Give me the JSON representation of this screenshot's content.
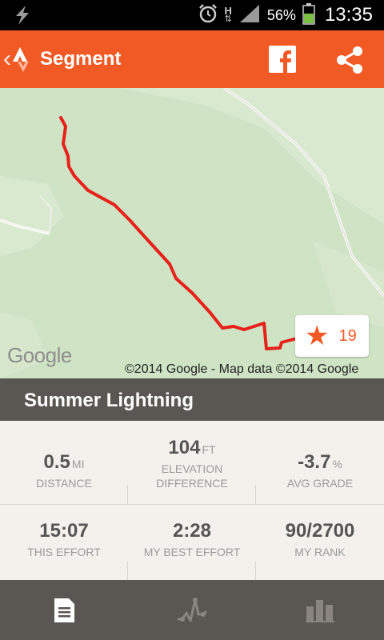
{
  "status_bar": {
    "battery_percent": "56%",
    "time": "13:35",
    "network_label": "H",
    "icons": [
      "lightning-icon",
      "alarm-icon",
      "data-arrows-icon",
      "signal-icon",
      "battery-icon"
    ]
  },
  "app_bar": {
    "title": "Segment",
    "icons": [
      "back-chevron-icon",
      "strava-logo-icon",
      "facebook-icon",
      "share-icon"
    ],
    "accent_color": "#f15a24"
  },
  "map": {
    "logo_text": "Google",
    "copyright": "©2014 Google - Map data ©2014 Google",
    "star_count": "19",
    "route_color": "#e8211a"
  },
  "segment": {
    "name": "Summer Lightning"
  },
  "stats": {
    "distance": {
      "value": "0.5",
      "unit": "MI",
      "label": "DISTANCE"
    },
    "elevation": {
      "value": "104",
      "unit": "FT",
      "label_line1": "ELEVATION",
      "label_line2": "DIFFERENCE"
    },
    "grade": {
      "value": "-3.7",
      "unit": "%",
      "label": "AVG GRADE"
    },
    "this_effort": {
      "value": "15:07",
      "label": "THIS EFFORT"
    },
    "best_effort": {
      "value": "2:28",
      "label": "MY BEST EFFORT"
    },
    "rank": {
      "value": "90/2700",
      "label": "MY RANK"
    }
  },
  "bottom_nav": {
    "tabs": [
      {
        "icon": "document-icon",
        "active": true
      },
      {
        "icon": "activity-graph-icon",
        "active": false
      },
      {
        "icon": "leaderboard-icon",
        "active": false
      }
    ]
  }
}
